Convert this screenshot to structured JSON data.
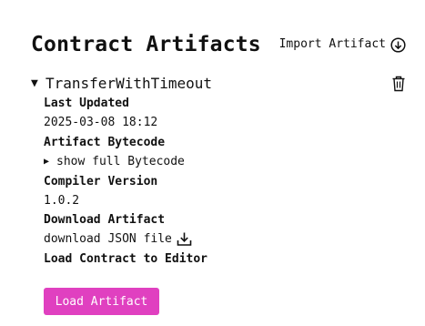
{
  "header": {
    "title": "Contract Artifacts",
    "import_label": "Import Artifact"
  },
  "artifact": {
    "name": "TransferWithTimeout",
    "fields": {
      "last_updated_label": "Last Updated",
      "last_updated_value": "2025-03-08 18:12",
      "bytecode_label": "Artifact Bytecode",
      "bytecode_toggle": "show full Bytecode",
      "compiler_label": "Compiler Version",
      "compiler_value": "1.0.2",
      "download_label": "Download Artifact",
      "download_link": "download JSON file",
      "load_label": "Load Contract to Editor",
      "load_button": "Load Artifact"
    }
  },
  "colors": {
    "accent": "#e040c0",
    "text": "#111111",
    "background": "#ffffff"
  },
  "icons": {
    "import": "arrow-down-circle-icon",
    "delete": "trash-icon",
    "download": "download-icon",
    "expanded": "triangle-down",
    "collapsed": "triangle-right"
  }
}
